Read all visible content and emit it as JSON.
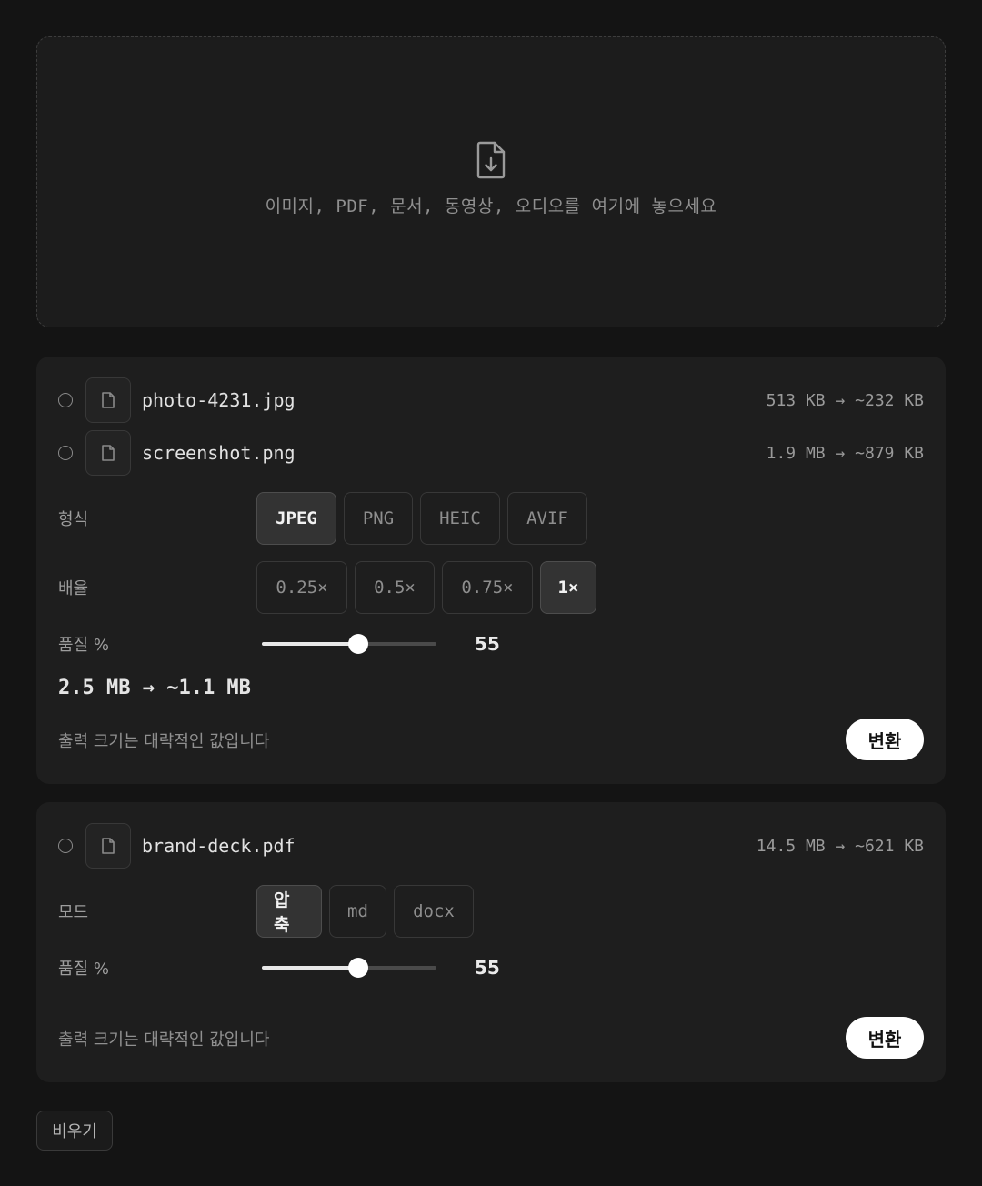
{
  "dropzone": {
    "icon": "file-download-icon",
    "text": "이미지, PDF, 문서, 동영상, 오디오를 여기에 놓으세요"
  },
  "image_group": {
    "files": [
      {
        "name": "photo-4231.jpg",
        "size": "513 KB → ~232 KB",
        "icon": "file-icon"
      },
      {
        "name": "screenshot.png",
        "size": "1.9 MB → ~879 KB",
        "icon": "file-icon"
      }
    ],
    "format": {
      "label": "형식",
      "options": [
        "JPEG",
        "PNG",
        "HEIC",
        "AVIF"
      ],
      "selected": "JPEG"
    },
    "scale": {
      "label": "배율",
      "options": [
        "0.25×",
        "0.5×",
        "0.75×",
        "1×"
      ],
      "selected": "1×"
    },
    "quality": {
      "label": "품질 %",
      "value": "55",
      "level": 0.55
    },
    "total": "2.5 MB → ~1.1 MB",
    "note": "출력 크기는 대략적인 값입니다",
    "convert_label": "변환"
  },
  "pdf_group": {
    "files": [
      {
        "name": "brand-deck.pdf",
        "size": "14.5 MB → ~621 KB",
        "icon": "file-icon"
      }
    ],
    "mode": {
      "label": "모드",
      "options": [
        "압축",
        "md",
        "docx"
      ],
      "selected": "압축"
    },
    "quality": {
      "label": "품질 %",
      "value": "55",
      "level": 0.55
    },
    "note": "출력 크기는 대략적인 값입니다",
    "convert_label": "변환"
  },
  "clear_label": "비우기",
  "colors": {
    "background": "#141414",
    "card": "#1e1e1e",
    "accent": "#ffffff"
  }
}
